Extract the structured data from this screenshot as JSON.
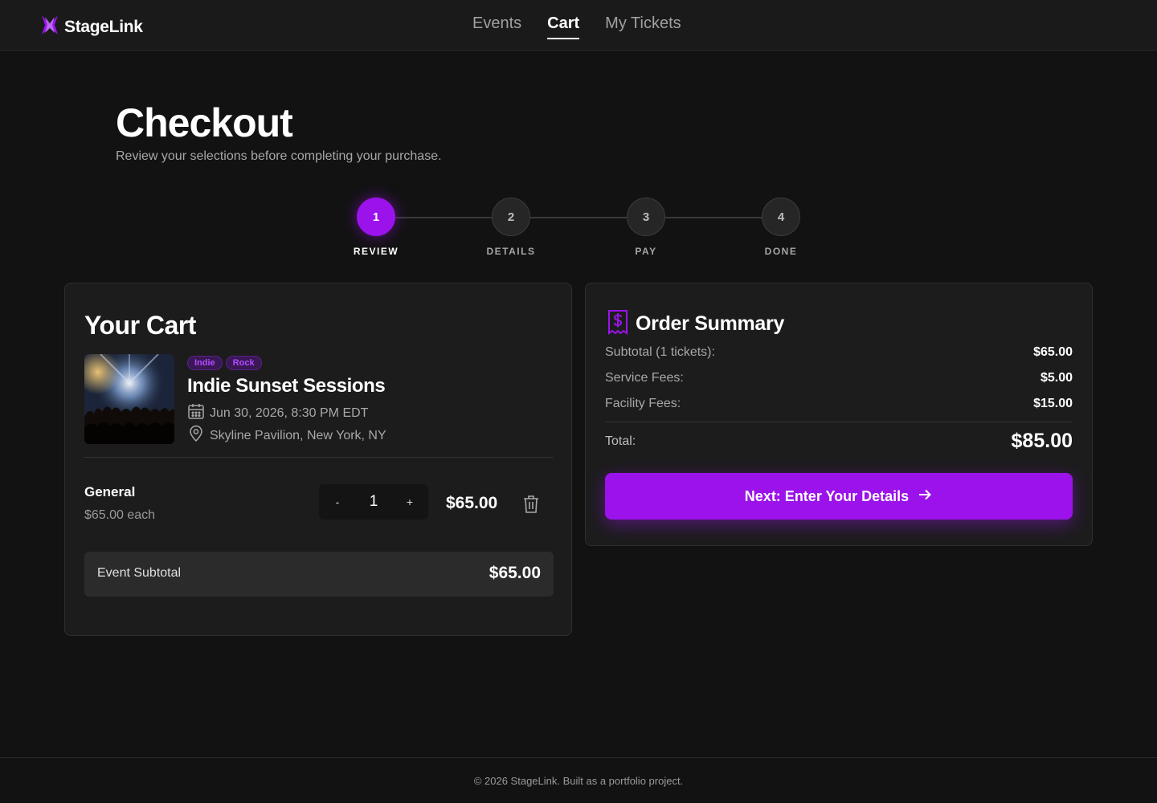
{
  "app": {
    "name": "StageLink"
  },
  "nav": [
    {
      "label": "Events",
      "active": false
    },
    {
      "label": "Cart",
      "active": true
    },
    {
      "label": "My Tickets",
      "active": false
    }
  ],
  "page": {
    "title": "Checkout",
    "subtitle": "Review your selections before completing your purchase."
  },
  "steps": [
    {
      "number": "1",
      "label": "REVIEW",
      "active": true
    },
    {
      "number": "2",
      "label": "DETAILS",
      "active": false
    },
    {
      "number": "3",
      "label": "PAY",
      "active": false
    },
    {
      "number": "4",
      "label": "DONE",
      "active": false
    }
  ],
  "cart": {
    "title": "Your Cart",
    "event": {
      "tags": [
        "Indie",
        "Rock"
      ],
      "name": "Indie Sunset Sessions",
      "date": "Jun 30, 2026, 8:30 PM EDT",
      "venue": "Skyline Pavilion, New York, NY"
    },
    "ticket": {
      "type": "General",
      "each": "$65.00 each",
      "decrement": "-",
      "quantity": "1",
      "increment": "+",
      "price": "$65.00"
    },
    "subtotal": {
      "label": "Event Subtotal",
      "value": "$65.00"
    }
  },
  "summary": {
    "title": "Order Summary",
    "rows": [
      {
        "label": "Subtotal (1 tickets):",
        "value": "$65.00"
      },
      {
        "label": "Service Fees:",
        "value": "$5.00"
      },
      {
        "label": "Facility Fees:",
        "value": "$15.00"
      }
    ],
    "total": {
      "label": "Total:",
      "value": "$85.00"
    },
    "next_button": "Next: Enter Your Details"
  },
  "footer": {
    "text": "© 2026 StageLink. Built as a portfolio project."
  },
  "colors": {
    "accent": "#9b13ea",
    "background": "#121212",
    "card": "#1c1c1c"
  },
  "icons": [
    "logo-icon",
    "calendar-icon",
    "location-pin-icon",
    "trash-icon",
    "receipt-dollar-icon",
    "arrow-right-icon"
  ]
}
